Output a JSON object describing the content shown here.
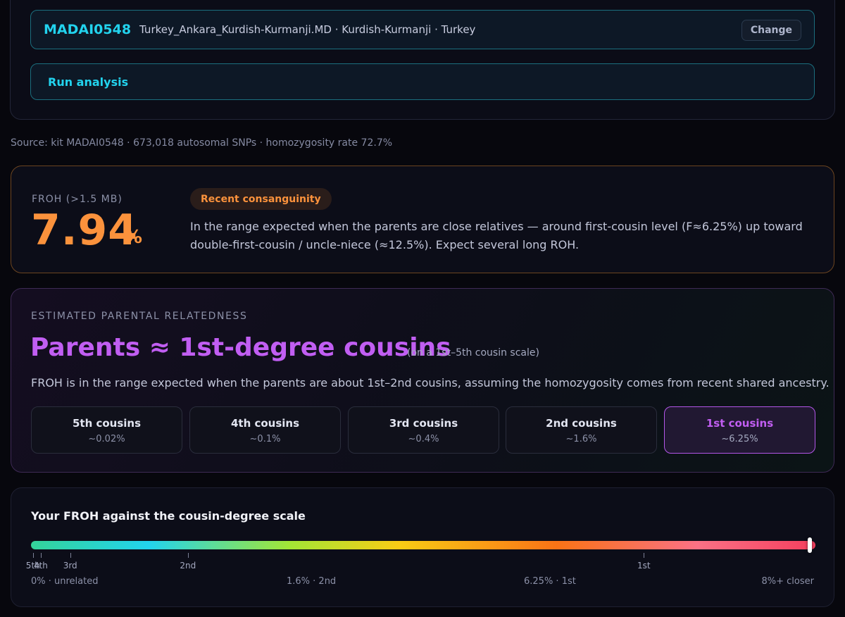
{
  "kit": {
    "id": "MADAI0548",
    "meta": "Turkey_Ankara_Kurdish-Kurmanji.MD · Kurdish-Kurmanji · Turkey",
    "change_label": "Change"
  },
  "run_label": "Run analysis",
  "source_text": "Source: kit MADAI0548 · 673,018 autosomal SNPs · homozygosity rate 72.7%",
  "froh": {
    "label": "FROH (>1.5 MB)",
    "value": "7.94",
    "unit": "%",
    "badge": "Recent consanguinity",
    "description": "In the range expected when the parents are close relatives — around first-cousin level (F≈6.25%) up toward double-first-cousin / uncle-niece (≈12.5%). Expect several long ROH."
  },
  "relatedness": {
    "label": "ESTIMATED PARENTAL RELATEDNESS",
    "title": "Parents ≈ 1st-degree cousins",
    "scale_note": "(on a 1st–5th cousin scale)",
    "description": "FROH is in the range expected when the parents are about 1st–2nd cousins, assuming the homozygosity comes from recent shared ancestry.",
    "options": [
      {
        "name": "5th cousins",
        "value": "~0.02%",
        "active": false
      },
      {
        "name": "4th cousins",
        "value": "~0.1%",
        "active": false
      },
      {
        "name": "3rd cousins",
        "value": "~0.4%",
        "active": false
      },
      {
        "name": "2nd cousins",
        "value": "~1.6%",
        "active": false
      },
      {
        "name": "1st cousins",
        "value": "~6.25%",
        "active": true
      }
    ]
  },
  "scale": {
    "title": "Your FROH against the cousin-degree scale",
    "max_percent": 8,
    "marker_percent": 7.94,
    "ticks": [
      {
        "label": "5th",
        "percent": 0.02
      },
      {
        "label": "4th",
        "percent": 0.1
      },
      {
        "label": "3rd",
        "percent": 0.4
      },
      {
        "label": "2nd",
        "percent": 1.6
      },
      {
        "label": "1st",
        "percent": 6.25
      }
    ],
    "axis_left": "0% · unrelated",
    "axis_mid1": "1.6% · 2nd",
    "axis_mid2": "6.25% · 1st",
    "axis_right": "8%+ closer"
  }
}
